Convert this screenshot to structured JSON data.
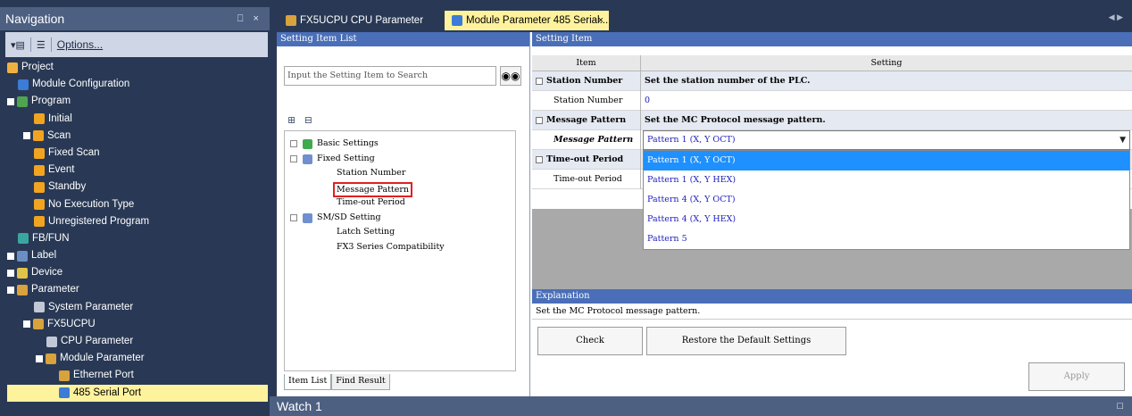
{
  "navigation": {
    "title": "Navigation",
    "pin": "⎕ ×",
    "toolbar": {
      "options": "Options..."
    },
    "tree": [
      {
        "label": "Project",
        "icon": "project-icon"
      },
      {
        "label": "Module Configuration",
        "icon": "module-config-icon"
      },
      {
        "label": "Program",
        "icon": "program-icon"
      },
      {
        "label": "Initial",
        "icon": "program-folder-icon"
      },
      {
        "label": "Scan",
        "icon": "program-folder-icon"
      },
      {
        "label": "Fixed Scan",
        "icon": "program-folder-icon"
      },
      {
        "label": "Event",
        "icon": "program-folder-icon"
      },
      {
        "label": "Standby",
        "icon": "program-folder-icon"
      },
      {
        "label": "No Execution Type",
        "icon": "program-folder-icon"
      },
      {
        "label": "Unregistered Program",
        "icon": "program-folder-icon"
      },
      {
        "label": "FB/FUN",
        "icon": "fb-icon"
      },
      {
        "label": "Label",
        "icon": "label-icon"
      },
      {
        "label": "Device",
        "icon": "device-icon"
      },
      {
        "label": "Parameter",
        "icon": "parameter-icon"
      },
      {
        "label": "System Parameter",
        "icon": "system-parameter-icon"
      },
      {
        "label": "FX5UCPU",
        "icon": "cpu-icon"
      },
      {
        "label": "CPU Parameter",
        "icon": "parameter-icon"
      },
      {
        "label": "Module Parameter",
        "icon": "parameter-icon"
      },
      {
        "label": "Ethernet Port",
        "icon": "ethernet-icon"
      },
      {
        "label": "485 Serial Port",
        "icon": "serial-port-icon"
      }
    ]
  },
  "tabs": {
    "inactive": "FX5UCPU CPU Parameter",
    "active": "Module Parameter 485 Serial...",
    "close": "×"
  },
  "setting_item_list": {
    "title": "Setting Item List",
    "search_placeholder": "Input the Setting Item to Search",
    "tree": {
      "basic": "Basic Settings",
      "fixed": "Fixed Setting",
      "station": "Station Number",
      "message": "Message Pattern",
      "timeout": "Time-out Period",
      "smsd": "SM/SD Setting",
      "latch": "Latch Setting",
      "fx3": "FX3 Series Compatibility"
    },
    "tabs": {
      "item_list": "Item List",
      "find_result": "Find Result"
    }
  },
  "setting_item": {
    "title": "Setting Item",
    "col_item": "Item",
    "col_setting": "Setting",
    "station_group": "Station Number",
    "station_desc": "Set the station number of the PLC.",
    "station_item": "Station Number",
    "station_value": "0",
    "message_group": "Message Pattern",
    "message_desc": "Set the MC Protocol message pattern.",
    "message_item": "Message Pattern",
    "message_value": "Pattern 1 (X, Y OCT)",
    "timeout_group": "Time-out Period",
    "timeout_item": "Time-out Period",
    "dropdown_options": [
      "Pattern 1 (X, Y OCT)",
      "Pattern 1 (X, Y HEX)",
      "Pattern 4 (X, Y OCT)",
      "Pattern 4 (X, Y HEX)",
      "Pattern 5"
    ]
  },
  "explanation": {
    "title": "Explanation",
    "text": "Set the MC Protocol message pattern."
  },
  "buttons": {
    "check": "Check",
    "restore": "Restore the Default Settings",
    "apply": "Apply"
  },
  "watch": {
    "title": "Watch 1"
  }
}
